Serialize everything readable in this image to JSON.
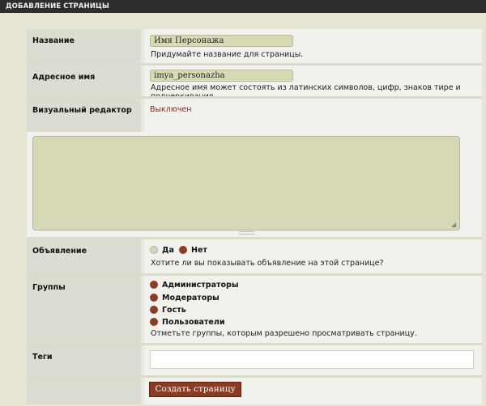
{
  "header": {
    "title": "Добавление страницы"
  },
  "form": {
    "name": {
      "label": "Название",
      "value": "Имя Персонажа",
      "hint": "Придумайте название для страницы."
    },
    "slug": {
      "label": "Адресное имя",
      "value": "imya_personazha",
      "hint": "Адресное имя может состоять из латинских символов, цифр, знаков тире и подчеркивания."
    },
    "visual_editor": {
      "label": "Визуальный редактор",
      "value": "Выключен"
    },
    "announcement": {
      "label": "Объявление",
      "options": [
        {
          "label": "Да",
          "selected": false
        },
        {
          "label": "Нет",
          "selected": true
        }
      ],
      "hint": "Хотите ли вы показывать объявление на этой странице?"
    },
    "groups": {
      "label": "Группы",
      "items": [
        "Администраторы",
        "Модераторы",
        "Гость",
        "Пользователи"
      ],
      "hint": "Отметьте группы, которым разрешено просматривать страницу."
    },
    "tags": {
      "label": "Теги",
      "value": ""
    },
    "submit_label": "Создать страницу"
  },
  "colors": {
    "accent": "#8b3a23",
    "input_bg": "#d9d9b6",
    "header_bg": "#2e2e2c",
    "label_bg": "#dddcd3",
    "field_bg": "#f1f1ed"
  }
}
